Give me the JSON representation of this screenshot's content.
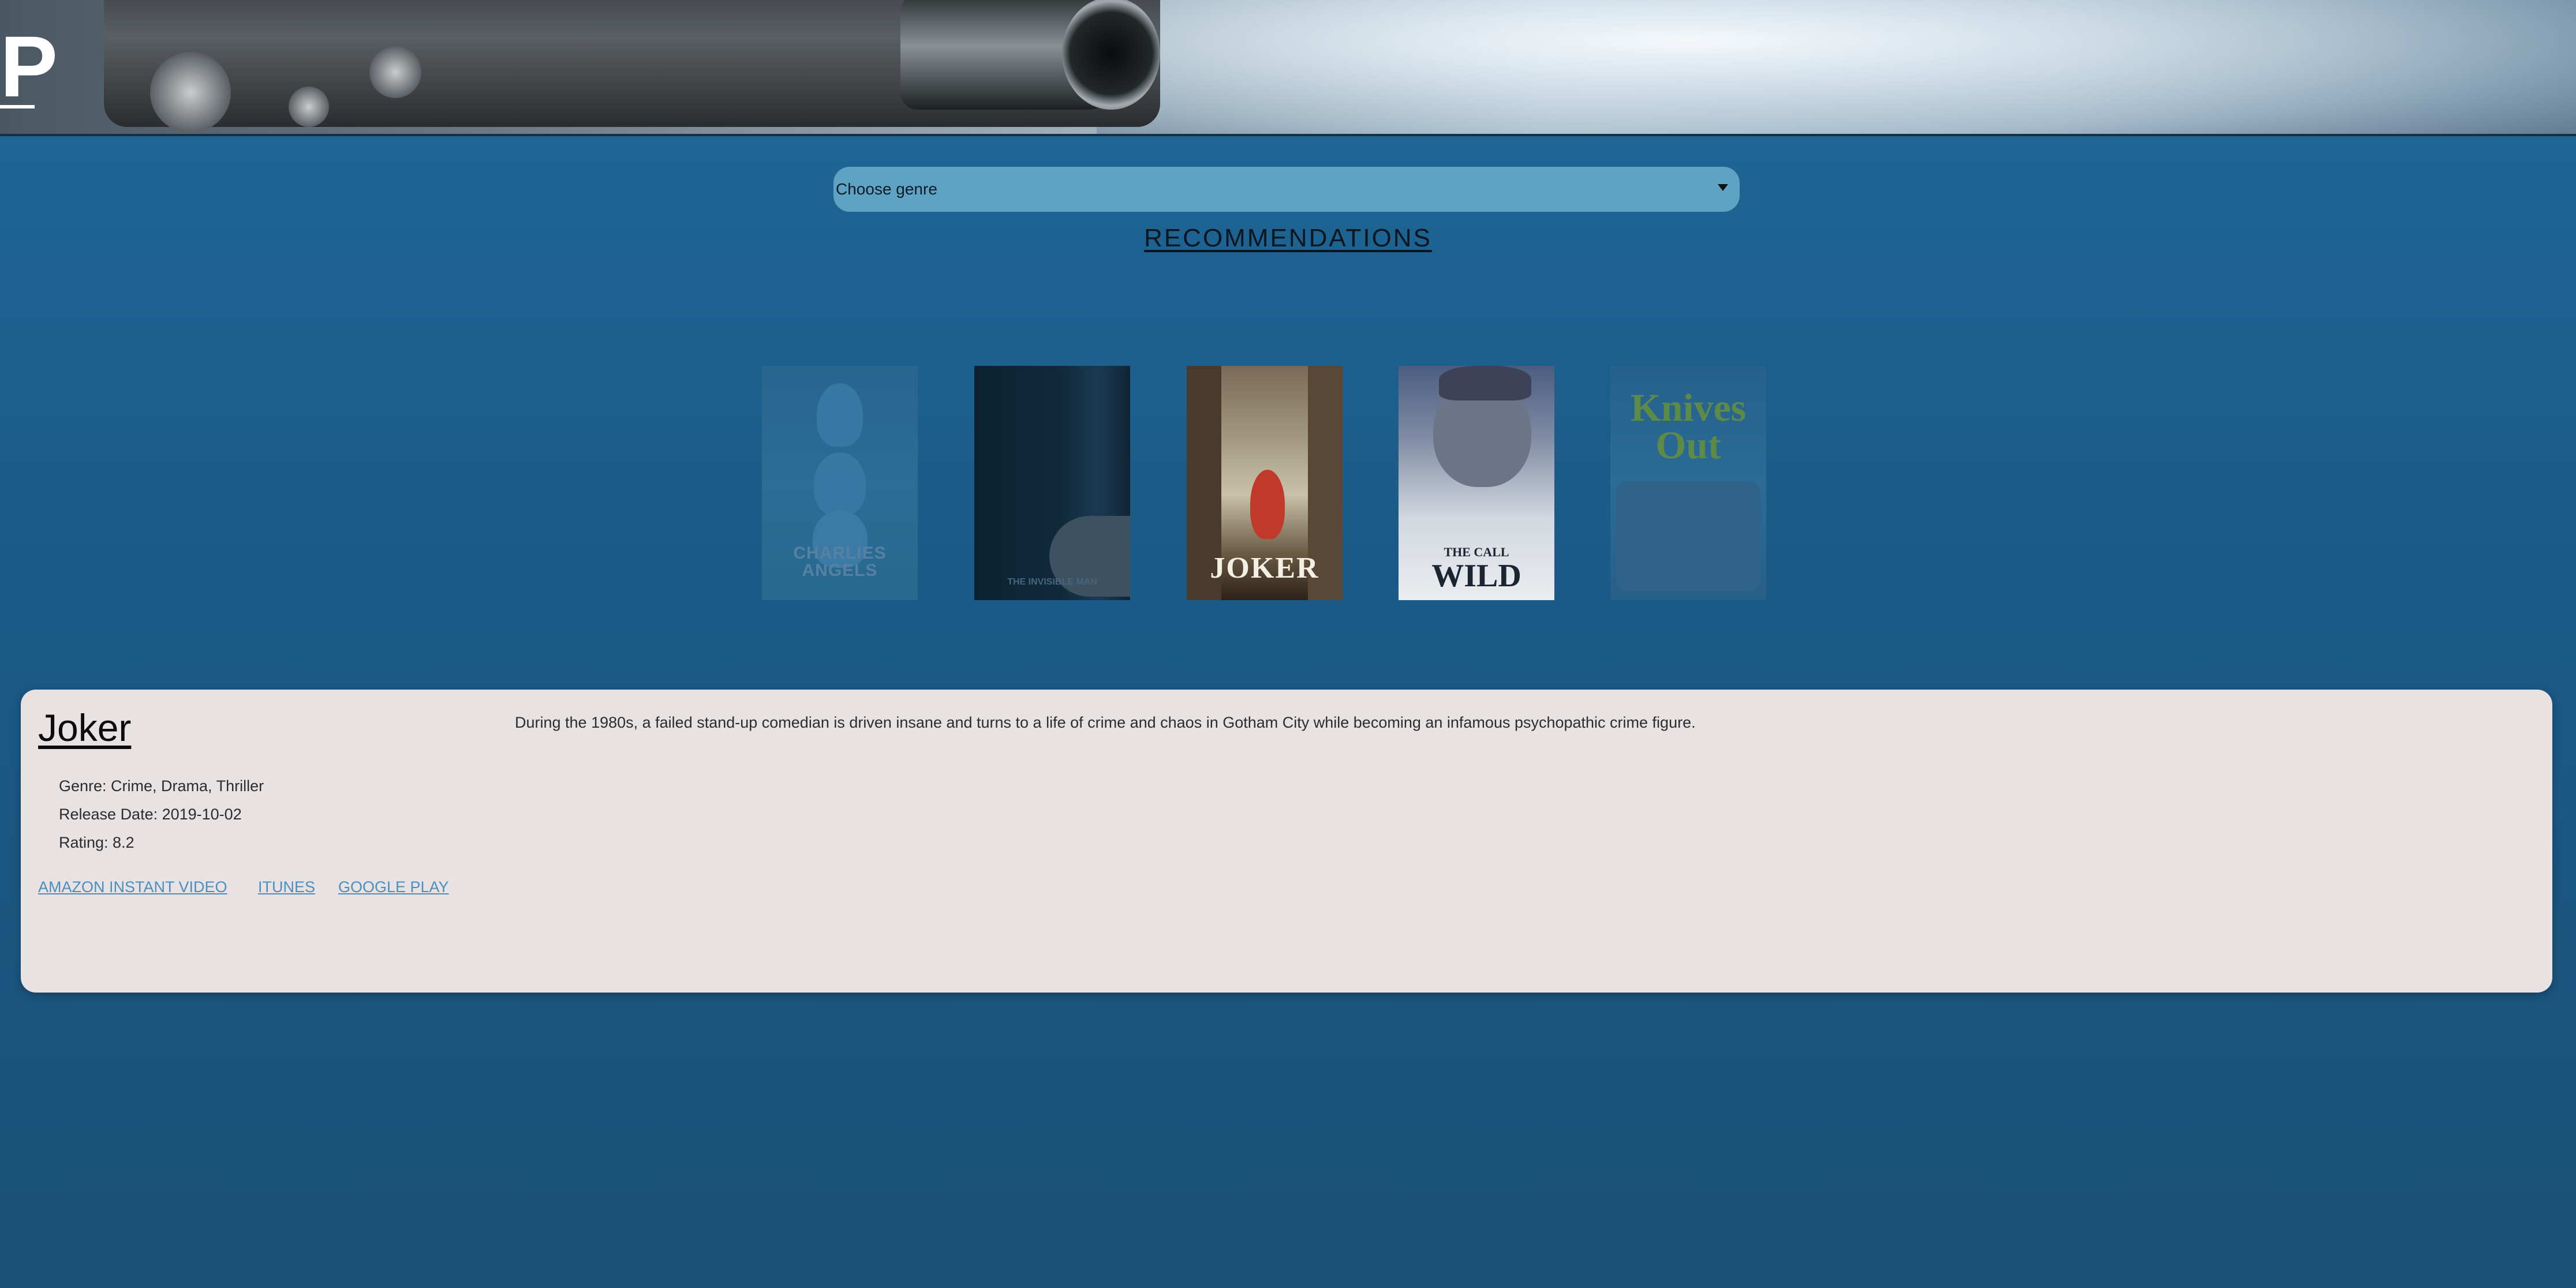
{
  "header": {
    "logo_text": "P"
  },
  "genre_select": {
    "value": "Choose genre"
  },
  "recommendations": {
    "title": "RECOMMENDATIONS",
    "posters": [
      {
        "name": "charlies-angels",
        "text_lines": [
          "CHARLIES",
          "ANGELS"
        ]
      },
      {
        "name": "the-invisible-man",
        "text": "THE INVISIBLE MAN"
      },
      {
        "name": "joker",
        "text": "JOKER"
      },
      {
        "name": "the-call-of-the-wild",
        "small": "THE CALL",
        "big": "WILD"
      },
      {
        "name": "knives-out",
        "text_lines": [
          "Knives",
          "Out"
        ]
      }
    ]
  },
  "detail": {
    "title": "Joker",
    "genre": "Genre: Crime, Drama, Thriller",
    "release_date": "Release Date: 2019-10-02",
    "rating": "Rating: 8.2",
    "description": "During the 1980s, a failed stand-up comedian is driven insane and turns to a life of crime and chaos in Gotham City while becoming an infamous psychopathic crime figure.",
    "links": [
      "AMAZON INSTANT VIDEO",
      "ITUNES",
      "GOOGLE PLAY"
    ]
  },
  "colors": {
    "background": "#1f6a9a",
    "select_bg": "#5fa3c4",
    "card_bg": "#e8e2e2",
    "link": "#4a8fbf"
  }
}
